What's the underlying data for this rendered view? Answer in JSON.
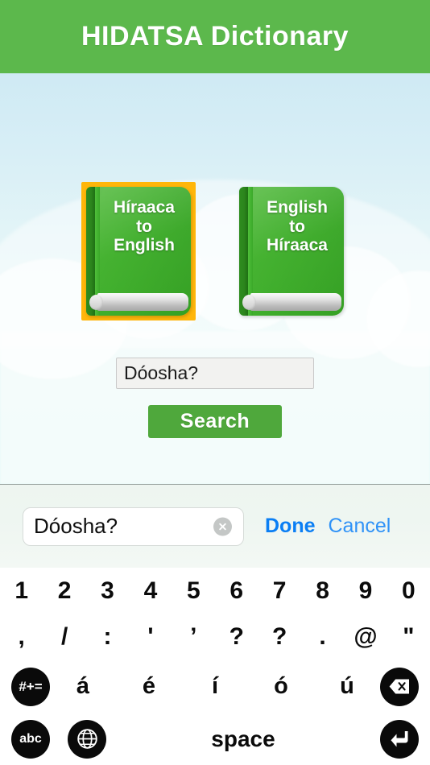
{
  "header": {
    "title": "HIDATSA Dictionary",
    "background_color": "#5cb84c",
    "text_color": "#ffffff"
  },
  "main": {
    "books": [
      {
        "id": "hiraaca-to-english",
        "label": "Híraaca\nto\nEnglish",
        "selected": true,
        "selection_color": "#ffb60a"
      },
      {
        "id": "english-to-hiraaca",
        "label": "English\nto\nHíraaca",
        "selected": false,
        "selection_color": "#ffb60a"
      }
    ],
    "search": {
      "value": "Dóosha?",
      "placeholder": "",
      "button_label": "Search",
      "button_color": "#4fa83c"
    }
  },
  "accessory_bar": {
    "input_value": "Dóosha?",
    "input_placeholder": "",
    "clear_icon": "clear-circle-icon",
    "done_label": "Done",
    "cancel_label": "Cancel",
    "link_color": "#0a7ef4"
  },
  "keyboard": {
    "row_numbers": [
      "1",
      "2",
      "3",
      "4",
      "5",
      "6",
      "7",
      "8",
      "9",
      "0"
    ],
    "row_punctuation": [
      ",",
      "/",
      ":",
      "'",
      "’",
      "?",
      "?",
      ".",
      "@",
      "\""
    ],
    "row_vowels": [
      "á",
      "é",
      "í",
      "ó",
      "ú"
    ],
    "symbols_key": "#+=",
    "letters_key": "abc",
    "globe_key": "globe-icon",
    "backspace_key": "backspace-icon",
    "return_key": "return-icon",
    "space_key": "space",
    "key_color": "#0a0a0a"
  }
}
